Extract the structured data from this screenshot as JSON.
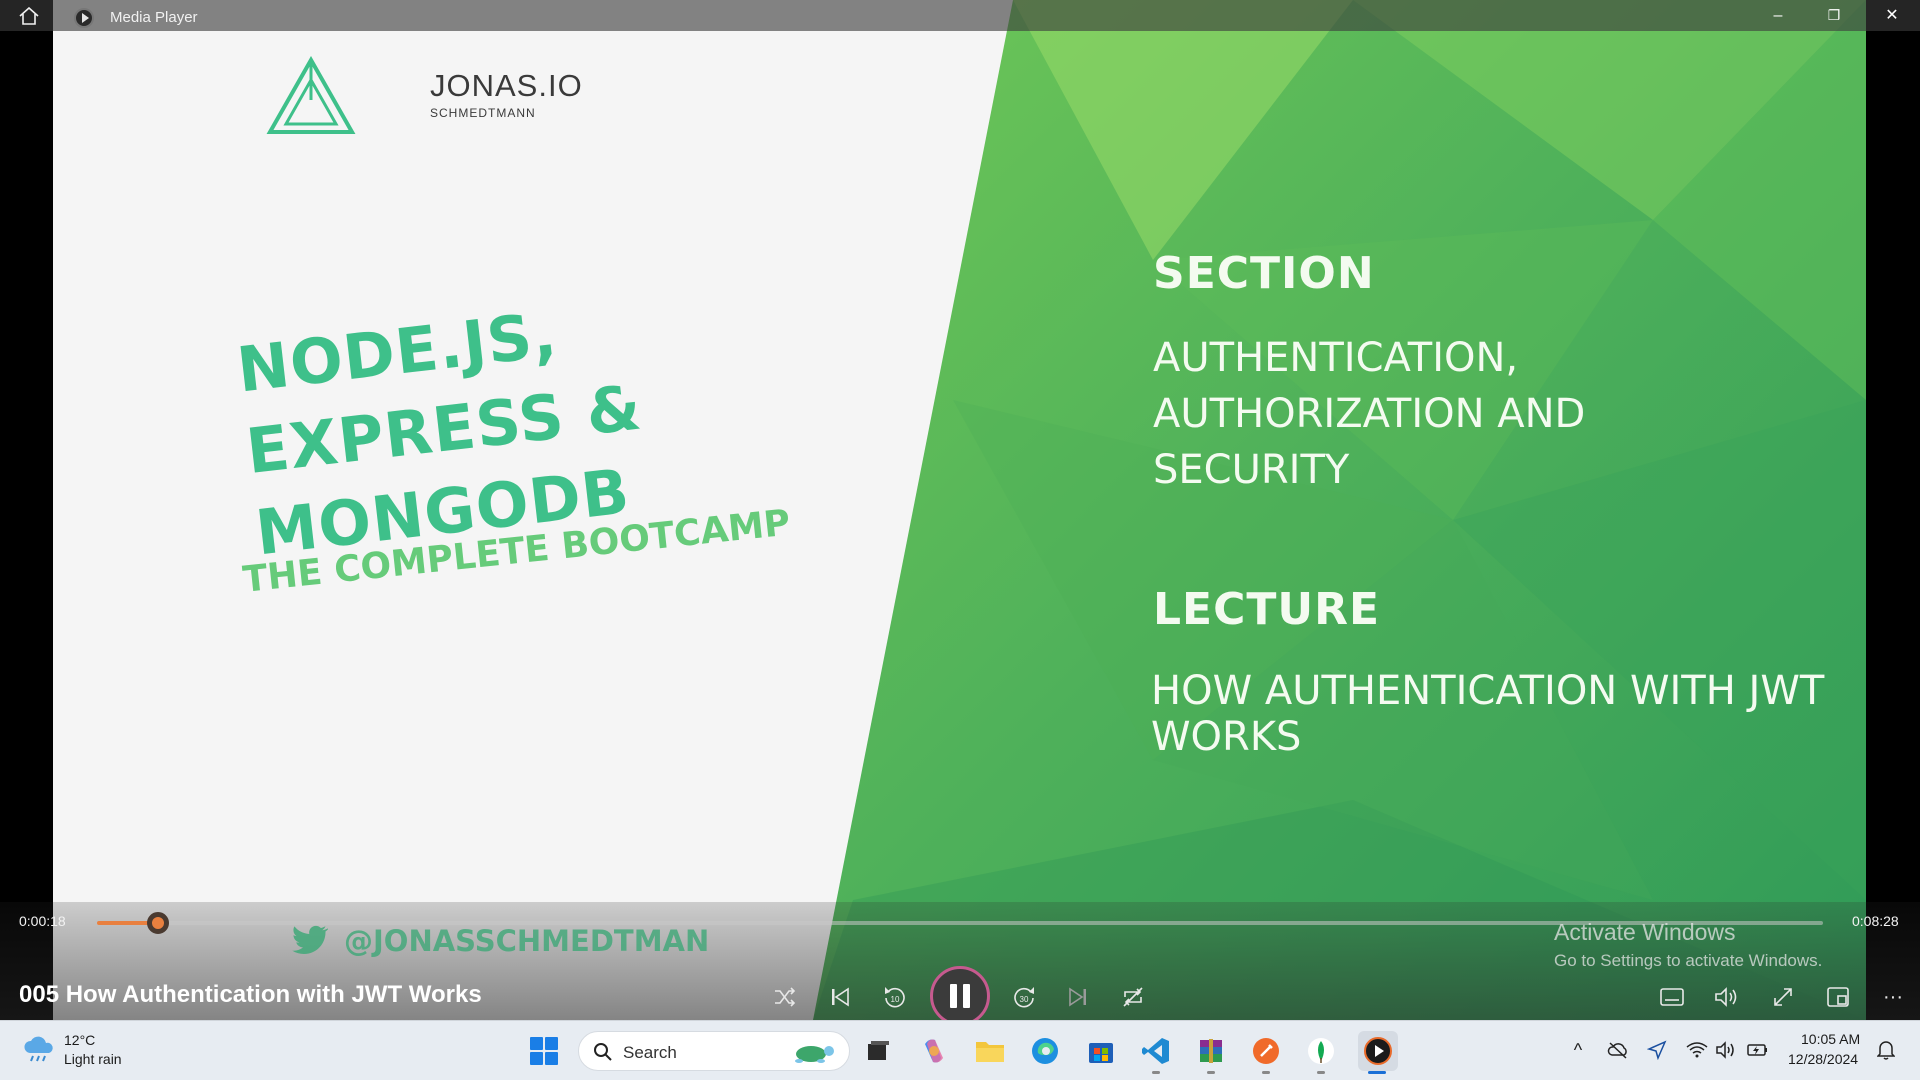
{
  "window": {
    "title": "Media Player",
    "minimize_glyph": "–",
    "restore_glyph": "❐",
    "close_glyph": "✕"
  },
  "slide": {
    "logo_name": "JONAS.IO",
    "logo_sub": "SCHMEDTMANN",
    "course_title_line1": "NODE.JS, EXPRESS &",
    "course_title_line2": "MONGODB",
    "course_subtitle": "THE COMPLETE BOOTCAMP",
    "twitter_handle": "@JONASSCHMEDTMAN",
    "section_heading": "SECTION",
    "section_name": "AUTHENTICATION, AUTHORIZATION AND SECURITY",
    "lecture_heading": "LECTURE",
    "lecture_name": "HOW AUTHENTICATION WITH JWT WORKS",
    "brand_green": "#3ec08a"
  },
  "player": {
    "elapsed": "0:00:18",
    "duration": "0:08:28",
    "progress_fraction": 0.0354,
    "video_title": "005 How Authentication with JWT Works",
    "accent": "#e9803f",
    "controls": [
      "shuffle-icon",
      "previous-icon",
      "rewind-10-icon",
      "pause-icon",
      "forward-30-icon",
      "next-icon",
      "repeat-icon",
      "subtitles-icon",
      "volume-icon",
      "fullscreen-icon",
      "miniplayer-icon",
      "more-icon"
    ],
    "skip_back_label": "10",
    "skip_forward_label": "30",
    "more_glyph": "···"
  },
  "activation": {
    "line1": "Activate Windows",
    "line2": "Go to Settings to activate Windows."
  },
  "taskbar": {
    "weather_temp": "12°C",
    "weather_desc": "Light rain",
    "search_label": "Search",
    "apps": [
      "task-view",
      "copilot",
      "file-explorer",
      "edge",
      "microsoft-store",
      "vscode",
      "winrar",
      "postman",
      "mongodb-compass",
      "media-player"
    ],
    "time": "10:05 AM",
    "date": "12/28/2024",
    "tray_chevron": "^"
  }
}
